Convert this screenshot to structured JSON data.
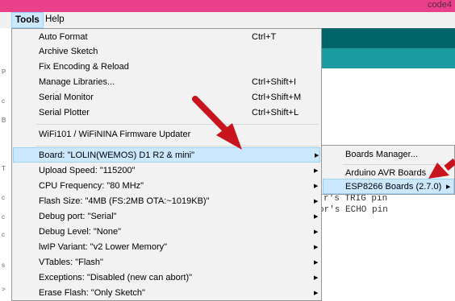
{
  "window": {
    "title_fragment": "code4"
  },
  "menubar": {
    "tools": "Tools",
    "help": "Help"
  },
  "tools_menu": {
    "items": [
      {
        "label": "Auto Format",
        "shortcut": "Ctrl+T"
      },
      {
        "label": "Archive Sketch",
        "shortcut": ""
      },
      {
        "label": "Fix Encoding & Reload",
        "shortcut": ""
      },
      {
        "label": "Manage Libraries...",
        "shortcut": "Ctrl+Shift+I"
      },
      {
        "label": "Serial Monitor",
        "shortcut": "Ctrl+Shift+M"
      },
      {
        "label": "Serial Plotter",
        "shortcut": "Ctrl+Shift+L"
      },
      {
        "label": "WiFi101 / WiFiNINA Firmware Updater",
        "shortcut": ""
      },
      {
        "label": "Board: \"LOLIN(WEMOS) D1 R2 & mini\"",
        "shortcut": ""
      },
      {
        "label": "Upload Speed: \"115200\"",
        "shortcut": ""
      },
      {
        "label": "CPU Frequency: \"80 MHz\"",
        "shortcut": ""
      },
      {
        "label": "Flash Size: \"4MB (FS:2MB OTA:~1019KB)\"",
        "shortcut": ""
      },
      {
        "label": "Debug port: \"Serial\"",
        "shortcut": ""
      },
      {
        "label": "Debug Level: \"None\"",
        "shortcut": ""
      },
      {
        "label": "lwIP Variant: \"v2 Lower Memory\"",
        "shortcut": ""
      },
      {
        "label": "VTables: \"Flash\"",
        "shortcut": ""
      },
      {
        "label": "Exceptions: \"Disabled (new can abort)\"",
        "shortcut": ""
      },
      {
        "label": "Erase Flash: \"Only Sketch\"",
        "shortcut": ""
      }
    ]
  },
  "boards_submenu": {
    "items": [
      {
        "label": "Boards Manager..."
      },
      {
        "label": "Arduino AVR Boards"
      },
      {
        "label": "ESP8266 Boards (2.7.0)"
      }
    ]
  },
  "editor": {
    "code_lines": [
      "r's TRIG pin",
      "or's ECHO pin"
    ]
  },
  "colors": {
    "title_bar": "#e8418a",
    "toolbar_dark": "#006468",
    "toolbar_light": "#1b9aa0",
    "highlight": "#cce8ff",
    "annotation_arrow": "#c8141c"
  }
}
